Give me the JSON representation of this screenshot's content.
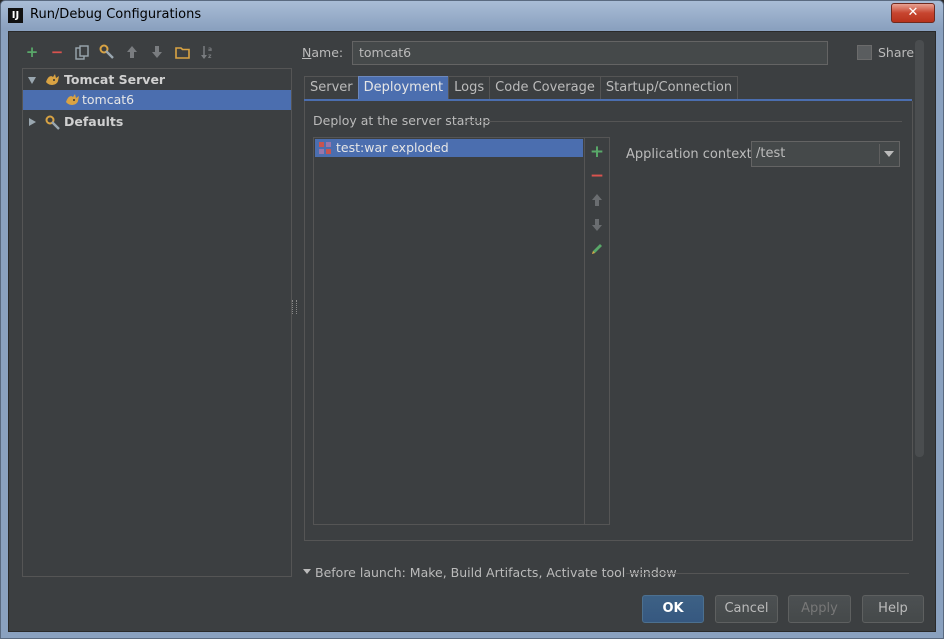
{
  "window": {
    "title": "Run/Debug Configurations",
    "close_glyph": "✕",
    "app_icon": "IJ"
  },
  "toolbar": {
    "add_glyph": "+",
    "remove_glyph": "−"
  },
  "tree": {
    "items": [
      {
        "label": "Tomcat Server",
        "icon": "tomcat-icon",
        "expanded": true
      },
      {
        "label": "tomcat6",
        "icon": "tomcat-icon",
        "selected": true
      },
      {
        "label": "Defaults",
        "icon": "wrench-icon",
        "expanded": false
      }
    ]
  },
  "name_field": {
    "label_prefix": "N",
    "label_rest": "ame:",
    "value": "tomcat6"
  },
  "share": {
    "label": "Share",
    "checked": false
  },
  "tabs": [
    {
      "label": "Server"
    },
    {
      "label": "Deployment",
      "active": true
    },
    {
      "label": "Logs"
    },
    {
      "label": "Code Coverage"
    },
    {
      "label": "Startup/Connection"
    }
  ],
  "deployment": {
    "section_label": "Deploy at the server startup",
    "artifacts": [
      {
        "label": "test:war exploded"
      }
    ],
    "add_glyph": "+",
    "remove_glyph": "−"
  },
  "app_context": {
    "label": "Application context:",
    "value": "/test"
  },
  "before_launch": {
    "text": "Before launch: Make, Build Artifacts, Activate tool window"
  },
  "buttons": {
    "ok": "OK",
    "cancel": "Cancel",
    "apply": "Apply",
    "help": "Help"
  },
  "colors": {
    "selection": "#4b6eaf",
    "background": "#3c3f41",
    "add_green": "#59a869",
    "remove_red": "#d9534f"
  }
}
